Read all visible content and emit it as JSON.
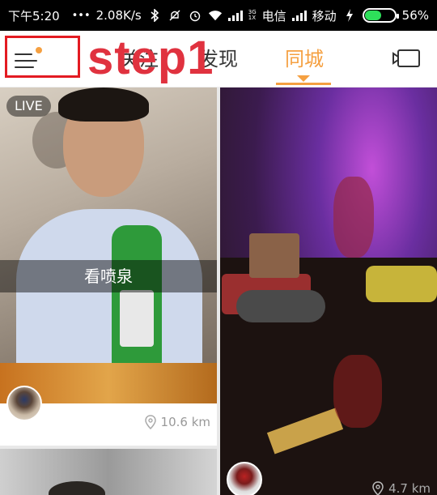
{
  "status_bar": {
    "time": "下午5:20",
    "dots": "•••",
    "speed": "2.08K/s",
    "network_top": "3G",
    "network_bottom": "1X",
    "carrier1": "电信",
    "carrier2": "移动",
    "battery_percent": "56%",
    "battery_level": 0.56,
    "icons": [
      "bluetooth-icon",
      "mute-icon",
      "alarm-icon",
      "wifi-icon",
      "signal-icon",
      "charging-icon",
      "battery-icon"
    ]
  },
  "nav": {
    "tabs": [
      {
        "id": "follow",
        "label": "关注"
      },
      {
        "id": "discover",
        "label": "发现"
      },
      {
        "id": "local",
        "label": "同城"
      }
    ],
    "active_tab": "local",
    "annotation": "step1",
    "accent_color": "#f5a041",
    "annotation_color": "#e0323f"
  },
  "feed": {
    "cards": [
      {
        "live_label": "LIVE",
        "caption": "看喷泉",
        "distance": "10.6 km"
      },
      {
        "distance": "4.7 km"
      }
    ]
  }
}
